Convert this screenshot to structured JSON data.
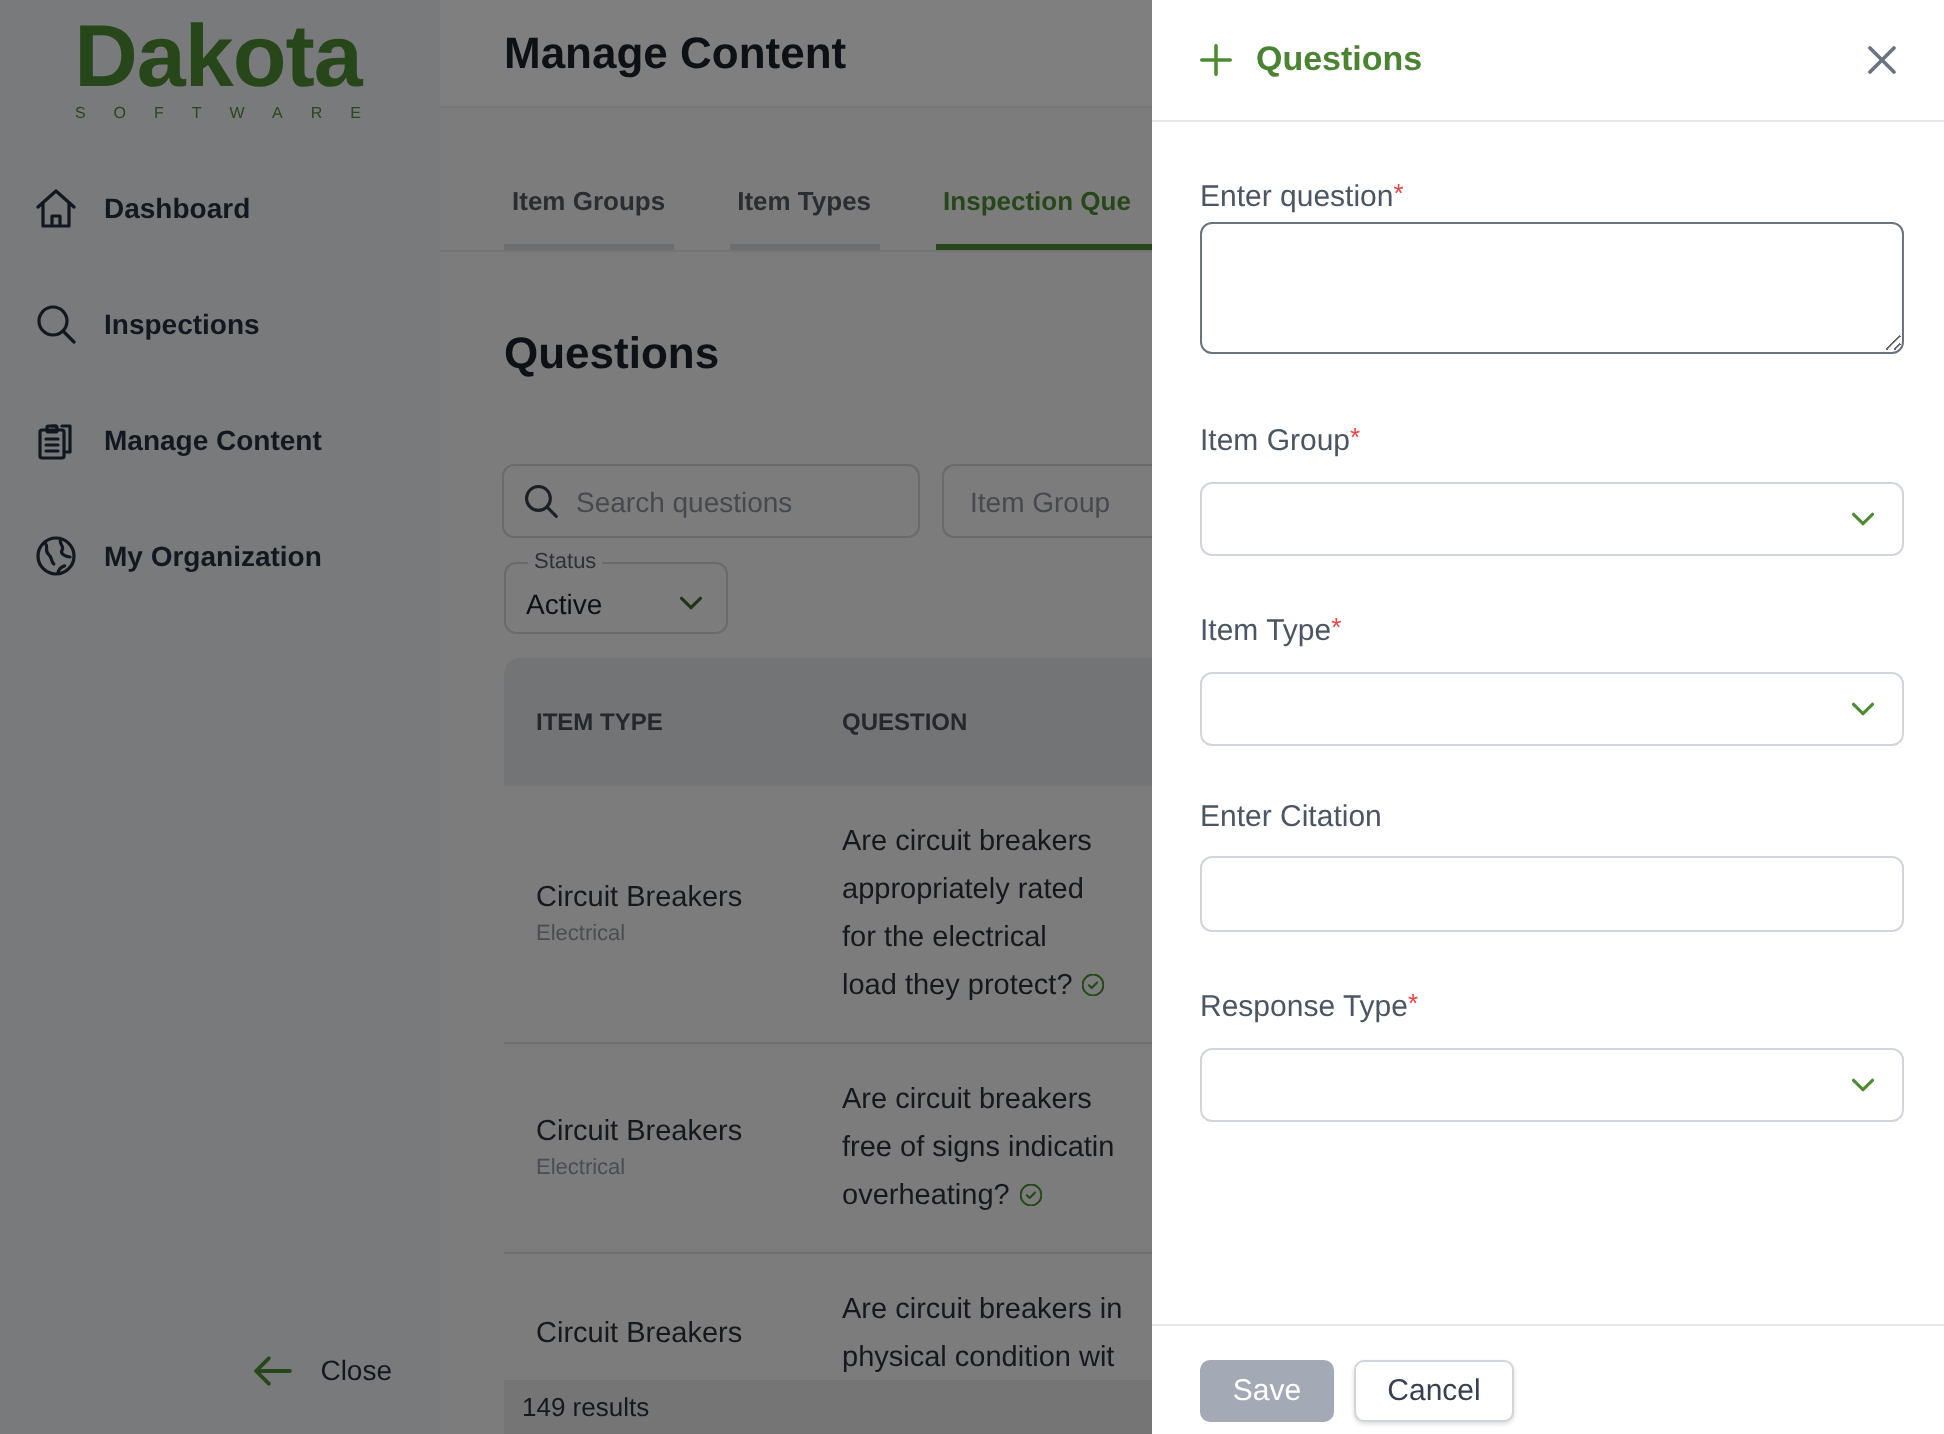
{
  "sidebar": {
    "logo": {
      "wordmark": "Dakota",
      "tagline": "SOFTWARE"
    },
    "nav": [
      {
        "label": "Dashboard"
      },
      {
        "label": "Inspections"
      },
      {
        "label": "Manage Content"
      },
      {
        "label": "My Organization"
      }
    ],
    "close_button": {
      "label": "Close"
    }
  },
  "header": {
    "title": "Manage Content"
  },
  "tabs": [
    {
      "label": "Item Groups",
      "selected": false
    },
    {
      "label": "Item Types",
      "selected": false
    },
    {
      "label": "Inspection Que",
      "selected": true
    }
  ],
  "section_title": "Questions",
  "filters": {
    "search": {
      "placeholder": "Search questions"
    },
    "item_group": {
      "placeholder": "Item Group"
    },
    "status": {
      "label": "Status",
      "value": "Active"
    }
  },
  "table": {
    "columns": [
      "ITEM TYPE",
      "QUESTION"
    ],
    "rows": [
      {
        "item_type": "Circuit Breakers",
        "item_group": "Electrical",
        "question_lines": [
          "Are circuit breakers",
          "appropriately rated",
          "for the electrical",
          "load they protect?"
        ],
        "verified": true
      },
      {
        "item_type": "Circuit Breakers",
        "item_group": "Electrical",
        "question_lines": [
          "Are circuit breakers",
          "free of signs indicatin",
          "overheating?"
        ],
        "verified": true
      },
      {
        "item_type": "Circuit Breakers",
        "question_lines": [
          "Are circuit breakers in",
          "physical condition wit"
        ],
        "verified": false
      }
    ],
    "results": "149 results"
  },
  "panel": {
    "title": "Questions",
    "fields": [
      {
        "kind": "textarea",
        "label": "Enter question",
        "required_mark": "*"
      },
      {
        "kind": "select",
        "label": "Item Group",
        "required_mark": "*"
      },
      {
        "kind": "select",
        "label": "Item Type",
        "required_mark": "*"
      },
      {
        "kind": "input",
        "label": "Enter Citation"
      },
      {
        "kind": "select",
        "label": "Response Type",
        "required_mark": "*"
      }
    ],
    "buttons": [
      {
        "label": "Save",
        "kind": "primary",
        "disabled": true
      },
      {
        "label": "Cancel",
        "kind": "secondary",
        "disabled": false
      }
    ]
  }
}
